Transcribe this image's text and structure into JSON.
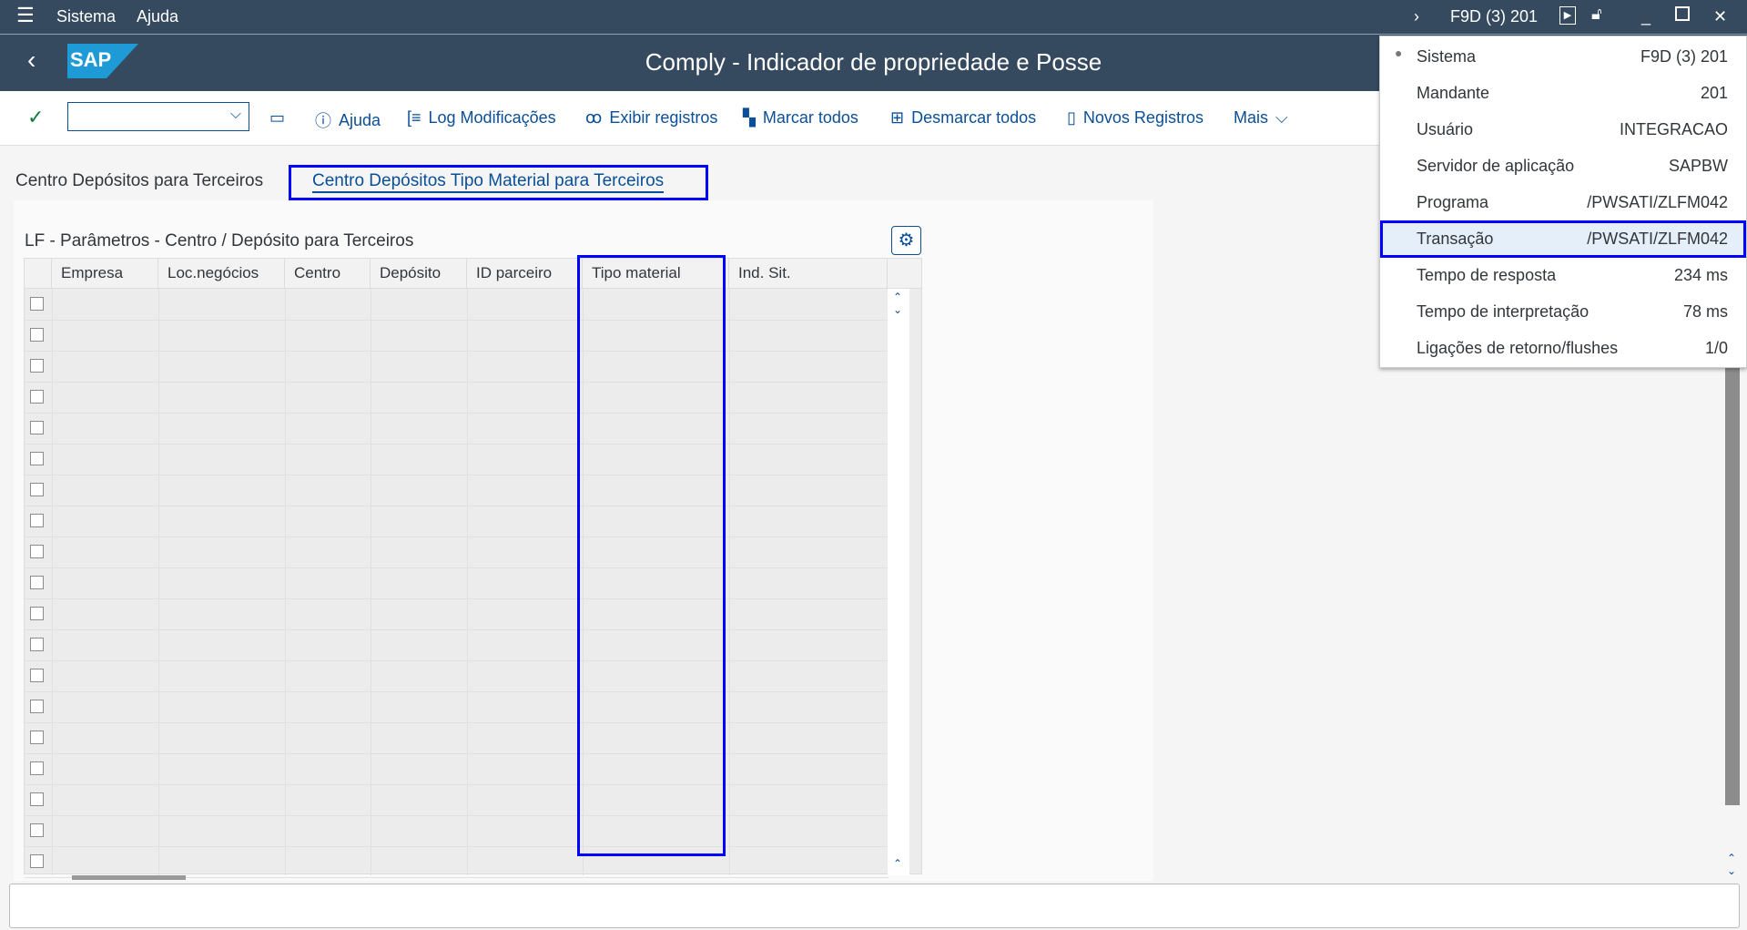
{
  "topbar": {
    "menu": [
      "Sistema",
      "Ajuda"
    ],
    "system": "F9D (3) 201"
  },
  "header": {
    "title": "Comply - Indicador de propriedade e Posse",
    "logo": "SAP"
  },
  "toolbar": {
    "command_value": "",
    "buttons": [
      "Ajuda",
      "Log Modificações",
      "Exibir registros",
      "Marcar todos",
      "Desmarcar todos",
      "Novos Registros",
      "Mais"
    ]
  },
  "tabs": [
    "Centro Depósitos para Terceiros",
    "Centro Depósitos Tipo Material para Terceiros"
  ],
  "table": {
    "title": "LF - Parâmetros - Centro / Depósito para Terceiros",
    "columns": [
      "Empresa",
      "Loc.negócios",
      "Centro",
      "Depósito",
      "ID parceiro",
      "Tipo material",
      "Ind. Sit."
    ],
    "row_count": 19
  },
  "popup": {
    "items": [
      {
        "label": "Sistema",
        "value": "F9D (3) 201"
      },
      {
        "label": "Mandante",
        "value": "201"
      },
      {
        "label": "Usuário",
        "value": "INTEGRACAO"
      },
      {
        "label": "Servidor de aplicação",
        "value": "SAPBW"
      },
      {
        "label": "Programa",
        "value": "/PWSATI/ZLFM042"
      },
      {
        "label": "Transação",
        "value": "/PWSATI/ZLFM042"
      },
      {
        "label": "Tempo de resposta",
        "value": "234 ms"
      },
      {
        "label": "Tempo de interpretação",
        "value": "78 ms"
      },
      {
        "label": "Ligações de retorno/flushes",
        "value": "1/0"
      }
    ]
  },
  "colors": {
    "shell": "#354a5f",
    "link": "#0a4f97",
    "highlight": "#0000ff"
  }
}
